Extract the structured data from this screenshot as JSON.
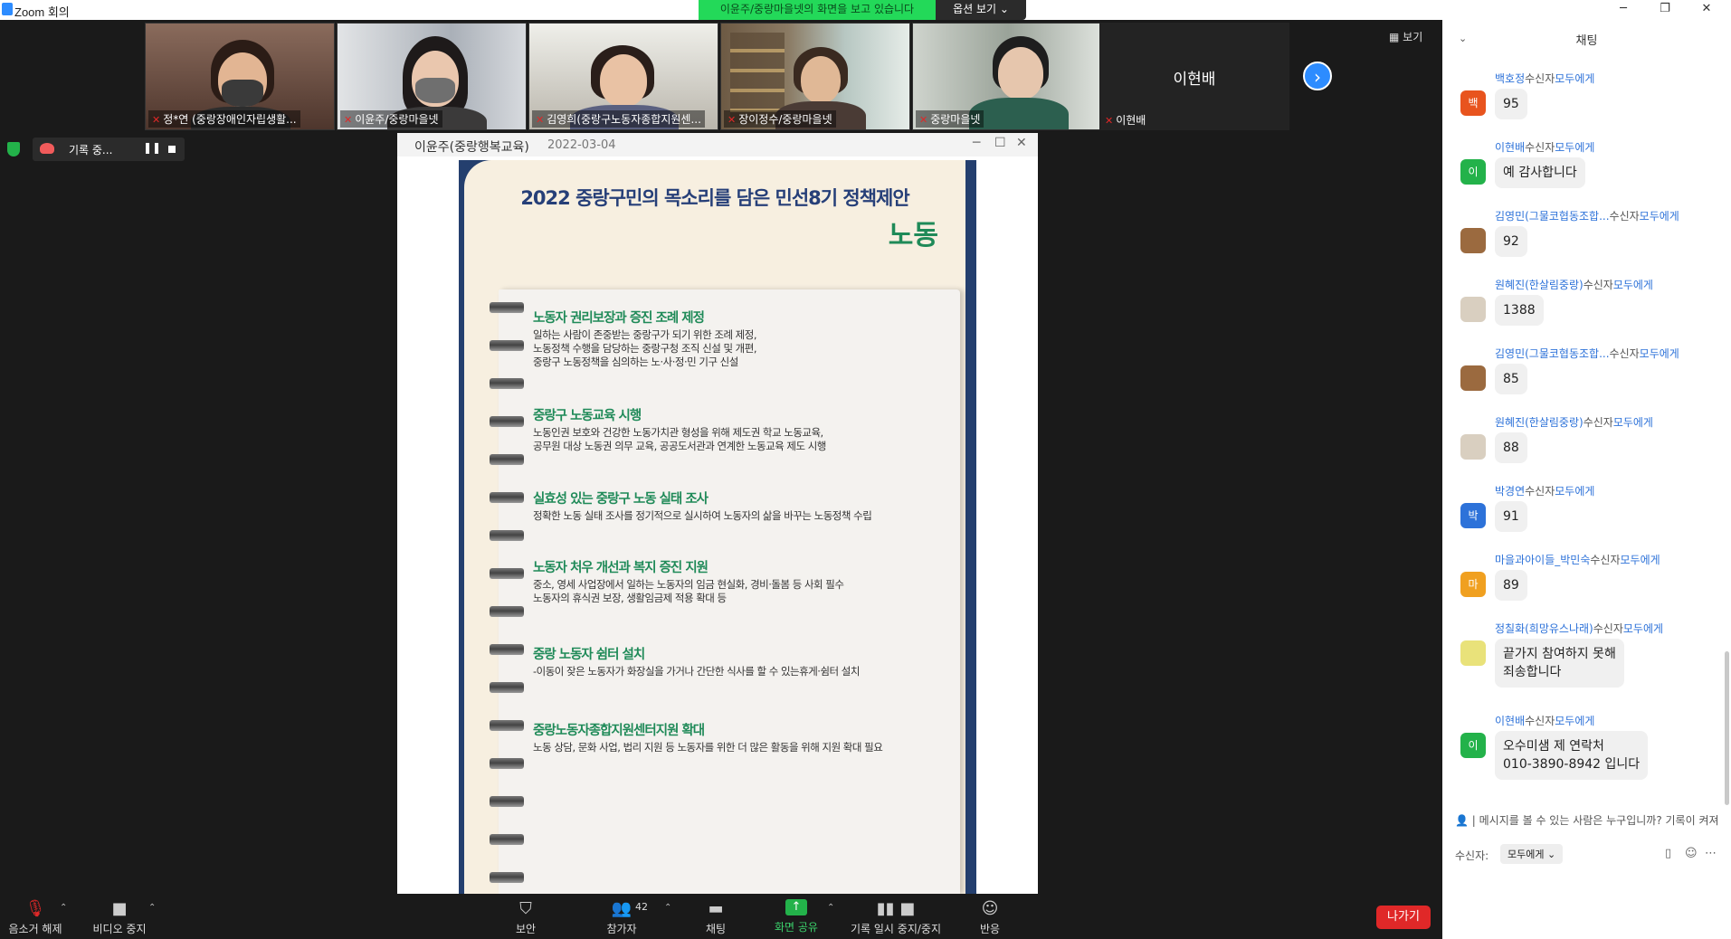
{
  "window": {
    "title": "Zoom 회의",
    "share_banner": "이윤주/중랑마을넷의 화면을 보고 있습니다",
    "view_options": "옵션 보기 ⌄",
    "minimize": "─",
    "maximize": "❐",
    "close": "✕"
  },
  "gallery": {
    "tiles": [
      {
        "name": "정*연 (중랑장애인자립생활..."
      },
      {
        "name": "이윤주/중랑마을넷"
      },
      {
        "name": "김영희(중랑구노동자종합지원센..."
      },
      {
        "name": "장이정수/중랑마을넷"
      },
      {
        "name": "중랑마을넷"
      },
      {
        "name": "이현배"
      }
    ],
    "name_only_tile": "이현배",
    "next_page": "›",
    "view_button": "▦ 보기"
  },
  "recording": {
    "label": "기록 중...",
    "pause": "❚❚"
  },
  "shared_window": {
    "title": "이윤주(중랑행복교육)",
    "date": "2022-03-04",
    "min": "─",
    "max": "☐",
    "close": "✕"
  },
  "poster": {
    "title": "2022 중랑구민의 목소리를 담은 민선8기 정책제안",
    "subject": "노동",
    "items": [
      {
        "title": "노동자 권리보장과 증진 조례 제정",
        "desc": "일하는 사람이 존중받는 중랑구가 되기 위한 조례 제정,\n노동정책 수행을 담당하는 중랑구청 조직 신설 및 개편,\n중랑구 노동정책을 심의하는 노·사·정·민 기구 신설"
      },
      {
        "title": "중랑구 노동교육 시행",
        "desc": "노동인권 보호와 건강한 노동가치관 형성을 위해 제도권 학교 노동교육,\n공무원 대상 노동권 의무 교육, 공공도서관과 연계한 노동교육 제도 시행"
      },
      {
        "title": "실효성 있는 중랑구 노동 실태 조사",
        "desc": "정확한 노동 실태 조사를 정기적으로 실시하여 노동자의 삶을 바꾸는 노동정책 수립"
      },
      {
        "title": "노동자 처우 개선과 복지 증진 지원",
        "desc": "중소, 영세 사업장에서 일하는 노동자의 임금 현실화, 경비·돌봄 등 사회 필수\n노동자의 휴식권 보장, 생활임금제 적용 확대 등"
      },
      {
        "title": "중랑 노동자 쉼터 설치",
        "desc": "-이동이 잦은 노동자가 화장실을 가거나 간단한 식사를 할 수 있는휴게·쉼터 설치"
      },
      {
        "title": "중랑노동자종합지원센터지원 확대",
        "desc": "노동 상담, 문화 사업, 법리 지원 등 노동자를 위한 더 많은 활동을 위해 지원 확대 필요"
      }
    ]
  },
  "toolbar": {
    "mute": "음소거 해제",
    "video": "비디오 중지",
    "security": "보안",
    "participants": "참가자",
    "participants_count": "42",
    "chat": "채팅",
    "share": "화면 공유",
    "recording": "기록 일시 중지/중지",
    "reactions": "반응",
    "leave": "나가기"
  },
  "chat": {
    "title": "채팅",
    "messages": [
      {
        "name": "백호정",
        "to": "모두에게",
        "avatar": "백",
        "avatar_color": "#e8541e",
        "text": "95"
      },
      {
        "name": "이현배",
        "to": "모두에게",
        "avatar": "이",
        "avatar_color": "#23b24a",
        "text": "예 감사합니다"
      },
      {
        "name": "김영민(그물코협동조합...",
        "to": "모두에게",
        "avatar": "",
        "avatar_color": "#9b6a3f",
        "text": "92"
      },
      {
        "name": "원혜진(한살림중랑)",
        "to": "모두에게",
        "avatar": "",
        "avatar_color": "#d9cfc0",
        "text": "1388"
      },
      {
        "name": "김영민(그물코협동조합...",
        "to": "모두에게",
        "avatar": "",
        "avatar_color": "#9b6a3f",
        "text": "85"
      },
      {
        "name": "원혜진(한살림중랑)",
        "to": "모두에게",
        "avatar": "",
        "avatar_color": "#d9cfc0",
        "text": "88"
      },
      {
        "name": "박경연",
        "to": "모두에게",
        "avatar": "박",
        "avatar_color": "#2d72d9",
        "text": "91"
      },
      {
        "name": "마을과아이들_박민숙",
        "to": "모두에게",
        "avatar": "마",
        "avatar_color": "#f0a020",
        "text": "89"
      },
      {
        "name": "정칠화(희망유스나래)",
        "to": "모두에게",
        "avatar": "",
        "avatar_color": "#e9e27a",
        "text": "끝가지 참여하지 못해\n죄송합니다"
      },
      {
        "name": "이현배",
        "to": "모두에게",
        "avatar": "이",
        "avatar_color": "#23b24a",
        "text": "오수미샘 제 연락처\n010-3890-8942 입니다"
      }
    ],
    "recipient_word": "수신자",
    "hint_prefix": "메시지를 볼 수 있는 사람은 누구입니까? 기록이 켜져",
    "recipient_label": "수신자:",
    "recipient_value": "모두에게 ⌄"
  }
}
